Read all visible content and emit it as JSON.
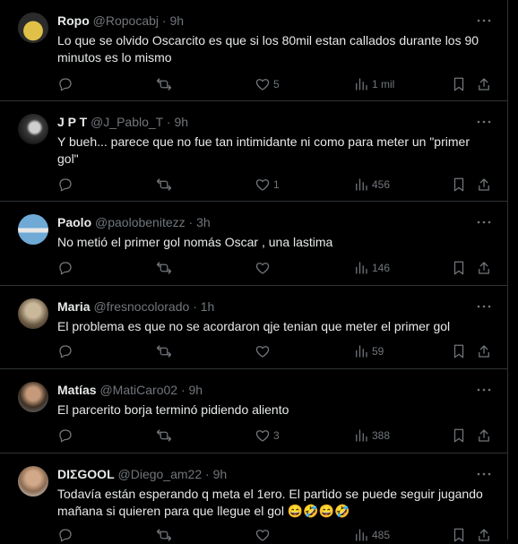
{
  "tweets": [
    {
      "name": "Ropo",
      "handle": "@Ropocabj",
      "time": "9h",
      "text": "Lo que se olvido Oscarcito es que si los 80mil estan callados durante los 90 minutos es lo mismo",
      "replies": "",
      "retweets": "",
      "likes": "5",
      "views": "1 mil",
      "avatar_color": "#c9a437"
    },
    {
      "name": "J P T",
      "handle": "@J_Pablo_T",
      "time": "9h",
      "text": "Y bueh... parece que no fue tan  intimidante  ni como para meter un \"primer gol\"",
      "replies": "",
      "retweets": "",
      "likes": "1",
      "views": "456",
      "avatar_color": "#5a5a5a"
    },
    {
      "name": "Paolo",
      "handle": "@paolobenitezz",
      "time": "3h",
      "text": "No metió el primer gol nomás Oscar , una lastima",
      "replies": "",
      "retweets": "",
      "likes": "",
      "views": "146",
      "avatar_color": "#7fb3d8"
    },
    {
      "name": "Maria",
      "handle": "@fresnocolorado",
      "time": "1h",
      "text": "El problema es que no se acordaron qje tenian que meter el primer gol",
      "replies": "",
      "retweets": "",
      "likes": "",
      "views": "59",
      "avatar_color": "#8c7a5e"
    },
    {
      "name": "Matías",
      "handle": "@MatiCaro02",
      "time": "9h",
      "text": "El parcerito borja terminó pidiendo aliento",
      "replies": "",
      "retweets": "",
      "likes": "3",
      "views": "388",
      "avatar_color": "#9a6b4f"
    },
    {
      "name": "DIΣGOOL",
      "handle": "@Diego_am22",
      "time": "9h",
      "text": "Todavía están esperando q meta el 1ero. El partido se puede seguir jugando mañana si quieren para que llegue el gol 😄🤣😄🤣",
      "replies": "",
      "retweets": "",
      "likes": "",
      "views": "485",
      "avatar_color": "#b89478"
    }
  ],
  "colors": {
    "background": "#000000",
    "text": "#e7e9ea",
    "muted": "#71767b",
    "divider": "#2f3336"
  },
  "icons": [
    "reply-icon",
    "retweet-icon",
    "like-icon",
    "views-icon",
    "bookmark-icon",
    "share-icon",
    "more-icon"
  ]
}
